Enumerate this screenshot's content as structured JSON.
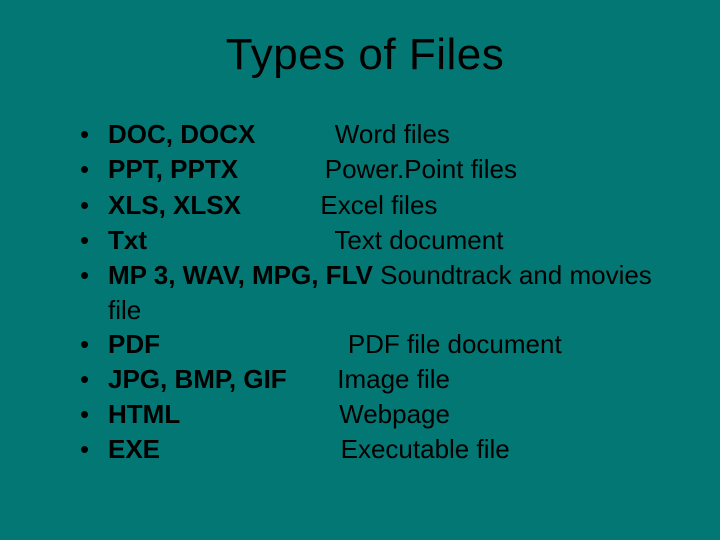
{
  "title": "Types of Files",
  "bullet_char": "•",
  "items": [
    {
      "ext": "DOC, DOCX",
      "gap": "           ",
      "desc": "Word files"
    },
    {
      "ext": "PPT, PPTX",
      "gap": "            ",
      "desc": "Power.Point files"
    },
    {
      "ext": "XLS, XLSX",
      "gap": "           ",
      "desc": "Excel files"
    },
    {
      "ext": "Txt",
      "gap": "                         ",
      "desc": " Text document"
    },
    {
      "ext": "MP 3, WAV, MPG, FLV",
      "gap": " ",
      "desc": "Soundtrack and movies",
      "continuation": "file"
    },
    {
      "ext": "PDF",
      "gap": "                         ",
      "desc": " PDF file document"
    },
    {
      "ext": "JPG, BMP, GIF",
      "gap": "      ",
      "desc": " Image file"
    },
    {
      "ext": "HTML",
      "gap": "                     ",
      "desc": " Webpage"
    },
    {
      "ext": "EXE",
      "gap": "                        ",
      "desc": " Executable file"
    }
  ]
}
